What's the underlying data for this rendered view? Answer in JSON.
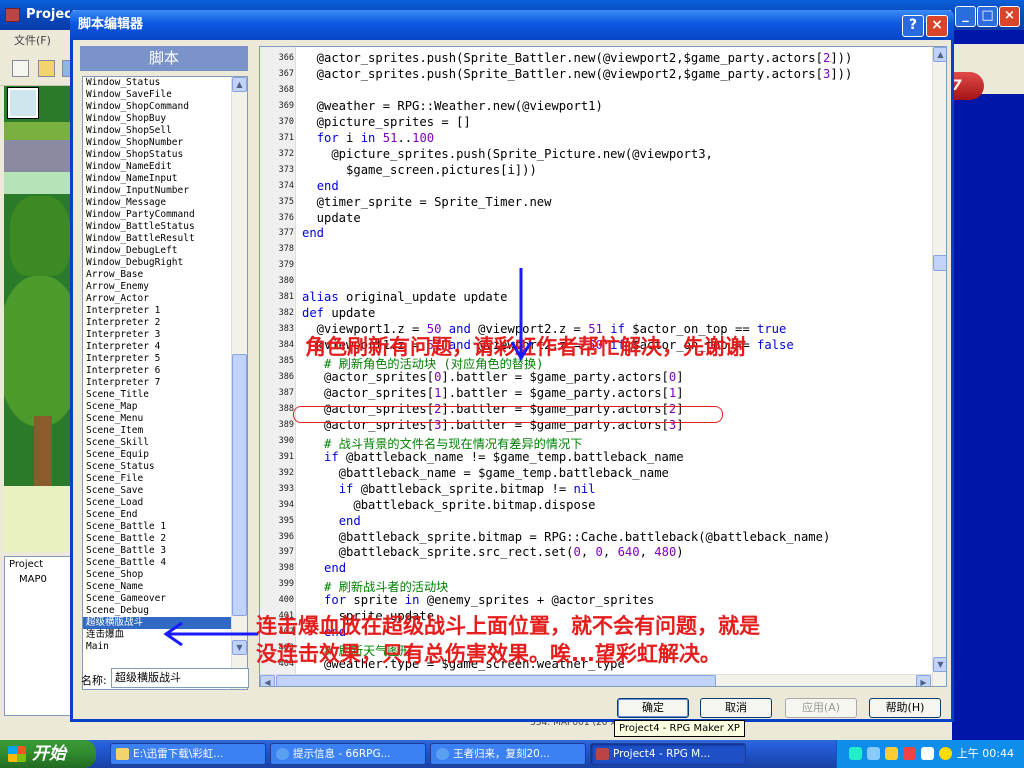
{
  "bg_window": {
    "title": "Project4 - RPG Maker XP",
    "title_visible": "Projec",
    "menu_file": "文件(F)",
    "project_tree": [
      "Project",
      "MAP0"
    ]
  },
  "dialog": {
    "title": "脚本编辑器",
    "help_label": "?",
    "close_label": "×",
    "script_header": "脚本",
    "name_label": "名称:",
    "name_value": "超级横版战斗",
    "buttons": {
      "ok": "确定",
      "cancel": "取消",
      "apply": "应用(A)",
      "help": "帮助(H)"
    }
  },
  "script_list": [
    "Window_Status",
    "Window_SaveFile",
    "Window_ShopCommand",
    "Window_ShopBuy",
    "Window_ShopSell",
    "Window_ShopNumber",
    "Window_ShopStatus",
    "Window_NameEdit",
    "Window_NameInput",
    "Window_InputNumber",
    "Window_Message",
    "Window_PartyCommand",
    "Window_BattleStatus",
    "Window_BattleResult",
    "Window_DebugLeft",
    "Window_DebugRight",
    "Arrow_Base",
    "Arrow_Enemy",
    "Arrow_Actor",
    "Interpreter 1",
    "Interpreter 2",
    "Interpreter 3",
    "Interpreter 4",
    "Interpreter 5",
    "Interpreter 6",
    "Interpreter 7",
    "Scene_Title",
    "Scene_Map",
    "Scene_Menu",
    "Scene_Item",
    "Scene_Skill",
    "Scene_Equip",
    "Scene_Status",
    "Scene_File",
    "Scene_Save",
    "Scene_Load",
    "Scene_End",
    "Scene_Battle 1",
    "Scene_Battle 2",
    "Scene_Battle 3",
    "Scene_Battle 4",
    "Scene_Shop",
    "Scene_Name",
    "Scene_Gameover",
    "Scene_Debug",
    "超级横版战斗",
    "连击爆血",
    "Main"
  ],
  "selected_script": "超级横版战斗",
  "code_lines": [
    {
      "n": "366",
      "t": "  @actor_sprites.push(Sprite_Battler.new(@viewport2,$game_party.actors[2]))"
    },
    {
      "n": "367",
      "t": "  @actor_sprites.push(Sprite_Battler.new(@viewport2,$game_party.actors[3]))"
    },
    {
      "n": "368",
      "t": ""
    },
    {
      "n": "369",
      "t": "  @weather = RPG::Weather.new(@viewport1)"
    },
    {
      "n": "370",
      "t": "  @picture_sprites = []"
    },
    {
      "n": "371",
      "t": "  for i in 51..100"
    },
    {
      "n": "372",
      "t": "    @picture_sprites.push(Sprite_Picture.new(@viewport3,"
    },
    {
      "n": "373",
      "t": "      $game_screen.pictures[i]))"
    },
    {
      "n": "374",
      "t": "  end"
    },
    {
      "n": "375",
      "t": "  @timer_sprite = Sprite_Timer.new"
    },
    {
      "n": "376",
      "t": "  update"
    },
    {
      "n": "377",
      "t": "end"
    },
    {
      "n": "378",
      "t": ""
    },
    {
      "n": "379",
      "t": ""
    },
    {
      "n": "380",
      "t": ""
    },
    {
      "n": "381",
      "t": "alias original_update update"
    },
    {
      "n": "382",
      "t": "def update"
    },
    {
      "n": "383",
      "t": "  @viewport1.z = 50 and @viewport2.z = 51 if $actor_on_top == true"
    },
    {
      "n": "384",
      "t": "  @viewport1.z = 51 and @viewport2.z = 50 if $actor_on_top == false"
    },
    {
      "n": "385",
      "t": "   # 刷新角色的活动块 (对应角色的替换)"
    },
    {
      "n": "386",
      "t": "   @actor_sprites[0].battler = $game_party.actors[0]"
    },
    {
      "n": "387",
      "t": "   @actor_sprites[1].battler = $game_party.actors[1]"
    },
    {
      "n": "388",
      "t": "   @actor_sprites[2].battler = $game_party.actors[2]"
    },
    {
      "n": "389",
      "t": "   @actor_sprites[3].battler = $game_party.actors[3]"
    },
    {
      "n": "390",
      "t": "   # 战斗背景的文件名与现在情况有差异的情况下"
    },
    {
      "n": "391",
      "t": "   if @battleback_name != $game_temp.battleback_name"
    },
    {
      "n": "392",
      "t": "     @battleback_name = $game_temp.battleback_name"
    },
    {
      "n": "393",
      "t": "     if @battleback_sprite.bitmap != nil"
    },
    {
      "n": "394",
      "t": "       @battleback_sprite.bitmap.dispose"
    },
    {
      "n": "395",
      "t": "     end"
    },
    {
      "n": "396",
      "t": "     @battleback_sprite.bitmap = RPG::Cache.battleback(@battleback_name)"
    },
    {
      "n": "397",
      "t": "     @battleback_sprite.src_rect.set(0, 0, 640, 480)"
    },
    {
      "n": "398",
      "t": "   end"
    },
    {
      "n": "399",
      "t": "   # 刷新战斗者的活动块"
    },
    {
      "n": "400",
      "t": "   for sprite in @enemy_sprites + @actor_sprites"
    },
    {
      "n": "401",
      "t": "     sprite.update"
    },
    {
      "n": "402",
      "t": "   end"
    },
    {
      "n": "403",
      "t": "   # 刷新天气图形"
    },
    {
      "n": "404",
      "t": "   @weather.type = $game_screen.weather_type"
    }
  ],
  "annotations": {
    "note_top": "角色刷新有问题，请彩虹作者帮忙解决，先谢谢",
    "note_bottom_1": "连击爆血放在超级战斗上面位置，就不会有问题，就是",
    "note_bottom_2": "没连击效果，只有总伤害效果。唉...望彩虹解决。",
    "color": "#e41d1d"
  },
  "xunlei_badge": "迅雷7",
  "tooltip": "Project4 - RPG Maker XP",
  "status_bar_text": "334: MAP001 (20 x 15) · 000,000 · 384: Event",
  "taskbar": {
    "start": "开始",
    "tasks": [
      "E:\\迅雷下载\\彩虹...",
      "提示信息 - 66RPG...",
      "王者归来，复刻20...",
      "Project4 - RPG M..."
    ],
    "clock": "上午 00:44"
  },
  "colors": {
    "title_blue": "#0b58e0",
    "keyword": "#0000d8",
    "number": "#8000c0",
    "comment": "#008000",
    "selection": "#316ac5"
  }
}
